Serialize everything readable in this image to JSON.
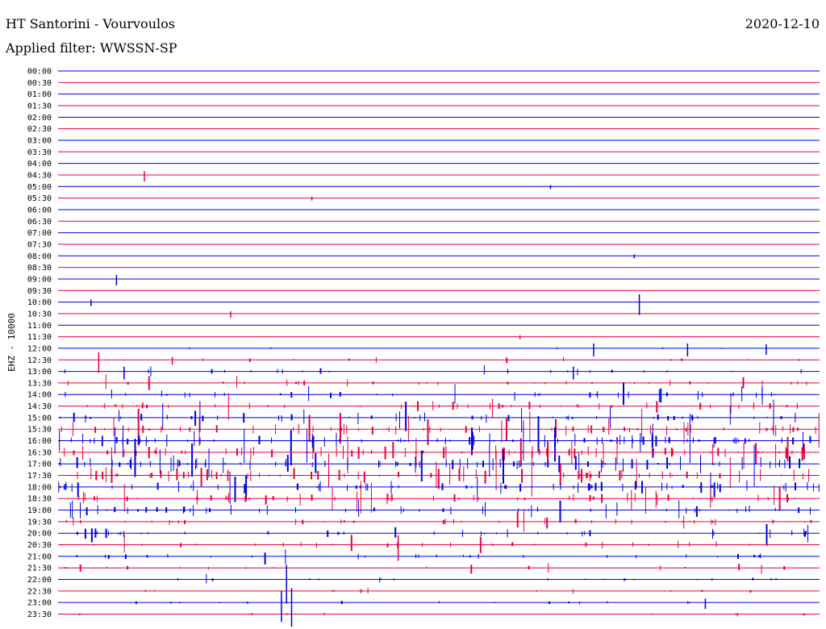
{
  "header": {
    "title": "HT Santorini - Vourvoulos",
    "filter": "Applied filter: WWSSN-SP",
    "date": "2020-12-10"
  },
  "chart_data": {
    "type": "line",
    "subtype": "helicorder",
    "title": "HT Santorini - Vourvoulos",
    "ylabel": "EHZ - 10000",
    "row_minutes": 30,
    "colors": [
      "#0000e0",
      "#e8003c"
    ],
    "row_labels": [
      "00:00",
      "00:30",
      "01:00",
      "01:30",
      "02:00",
      "02:30",
      "03:00",
      "03:30",
      "04:00",
      "04:30",
      "05:00",
      "05:30",
      "06:00",
      "06:30",
      "07:00",
      "07:30",
      "08:00",
      "08:30",
      "09:00",
      "09:30",
      "10:00",
      "10:30",
      "11:00",
      "11:30",
      "12:00",
      "12:30",
      "13:00",
      "13:30",
      "14:00",
      "14:30",
      "15:00",
      "15:30",
      "16:00",
      "16:30",
      "17:00",
      "17:30",
      "18:00",
      "18:30",
      "19:00",
      "19:30",
      "20:00",
      "20:30",
      "21:00",
      "21:30",
      "22:00",
      "22:30",
      "23:00",
      "23:30"
    ],
    "activity": [
      0,
      0,
      0,
      0,
      0,
      0,
      0,
      0,
      0,
      0,
      0,
      0,
      0,
      0,
      0,
      0,
      0,
      0,
      0,
      0,
      0,
      0,
      0,
      0,
      0.05,
      0.15,
      0.25,
      0.35,
      0.45,
      0.55,
      0.65,
      0.85,
      1,
      1,
      1,
      0.9,
      0.8,
      0.7,
      0.6,
      0.5,
      0.45,
      0.4,
      0.3,
      0.2,
      0.2,
      0.15,
      0.15,
      0.1
    ],
    "events": [
      {
        "row": 9,
        "minute": 3.4,
        "amp": 8
      },
      {
        "row": 10,
        "minute": 19.4,
        "amp": 3
      },
      {
        "row": 11,
        "minute": 10.0,
        "amp": 3
      },
      {
        "row": 16,
        "minute": 22.7,
        "amp": 3
      },
      {
        "row": 18,
        "minute": 2.3,
        "amp": 8
      },
      {
        "row": 20,
        "minute": 1.3,
        "amp": 5
      },
      {
        "row": 20,
        "minute": 22.9,
        "amp": 16
      },
      {
        "row": 21,
        "minute": 6.8,
        "amp": 5
      },
      {
        "row": 23,
        "minute": 18.2,
        "amp": 3
      },
      {
        "row": 24,
        "minute": 21.1,
        "amp": 10
      },
      {
        "row": 24,
        "minute": 24.8,
        "amp": 10
      },
      {
        "row": 24,
        "minute": 27.9,
        "amp": 8
      },
      {
        "row": 25,
        "minute": 1.6,
        "amp": 16
      },
      {
        "row": 25,
        "minute": 4.5,
        "amp": 6
      },
      {
        "row": 26,
        "minute": 20.3,
        "amp": 10
      },
      {
        "row": 26,
        "minute": 2.6,
        "amp": 10
      },
      {
        "row": 41,
        "minute": 13.4,
        "amp": 20
      },
      {
        "row": 44,
        "minute": 9.0,
        "amp": 30
      },
      {
        "row": 46,
        "minute": 8.8,
        "amp": 24
      },
      {
        "row": 46,
        "minute": 9.2,
        "amp": 30
      },
      {
        "row": 46,
        "minute": 25.5,
        "amp": 8
      }
    ]
  }
}
